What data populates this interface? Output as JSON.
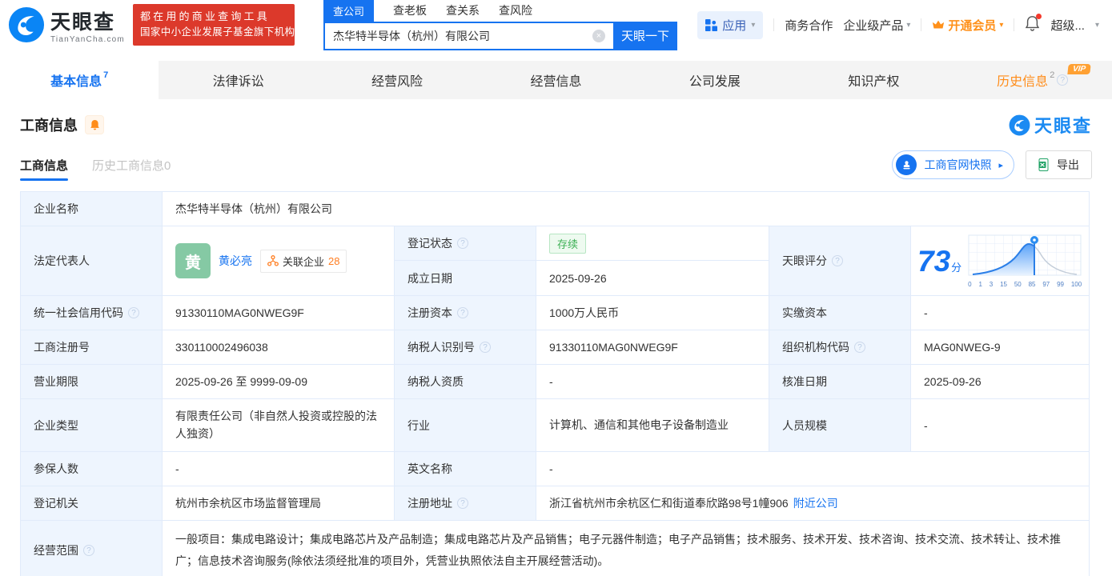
{
  "icons": {
    "caret": "▾",
    "arrow_right": "▸",
    "clear": "×",
    "help": "?",
    "vip": "VIP",
    "dots": "…"
  },
  "header": {
    "logo": {
      "brand": "天眼查",
      "domain": "TianYanCha.com"
    },
    "banner": {
      "line1": "都在用的商业查询工具",
      "line2": "国家中小企业发展子基金旗下机构"
    },
    "search": {
      "tabs": [
        {
          "label": "查公司"
        },
        {
          "label": "查老板"
        },
        {
          "label": "查关系"
        },
        {
          "label": "查风险"
        }
      ],
      "value": "杰华特半导体（杭州）有限公司",
      "button": "天眼一下"
    },
    "menu": {
      "apps": "应用",
      "business_coop": "商务合作",
      "enterprise_product": "企业级产品",
      "vip": "开通会员",
      "username": "超级..."
    }
  },
  "nav_tabs": [
    {
      "label": "基本信息",
      "count": "7"
    },
    {
      "label": "法律诉讼"
    },
    {
      "label": "经营风险"
    },
    {
      "label": "经营信息"
    },
    {
      "label": "公司发展"
    },
    {
      "label": "知识产权"
    },
    {
      "label": "历史信息",
      "count": "2"
    }
  ],
  "section": {
    "title": "工商信息",
    "watermark": "天眼查",
    "sub_tabs": [
      {
        "label": "工商信息"
      },
      {
        "label": "历史工商信息0"
      }
    ],
    "snapshot_button": "工商官网快照",
    "export_button": "导出"
  },
  "table": {
    "row1": {
      "label": "企业名称",
      "value": "杰华特半导体（杭州）有限公司"
    },
    "row2": {
      "label": "法定代表人",
      "avatar": "黄",
      "name": "黄必亮",
      "related_label": "关联企业",
      "related_count": "28",
      "reg_status_label": "登记状态",
      "reg_status": "存续",
      "establish_label": "成立日期",
      "establish_date": "2025-09-26",
      "score_label": "天眼评分",
      "score": "73",
      "score_unit": "分"
    },
    "row3": {
      "l1": "统一社会信用代码",
      "v1": "91330110MAG0NWEG9F",
      "l2": "注册资本",
      "v2": "1000万人民币",
      "l3": "实缴资本",
      "v3": "-"
    },
    "row4": {
      "l1": "工商注册号",
      "v1": "330110002496038",
      "l2": "纳税人识别号",
      "v2": "91330110MAG0NWEG9F",
      "l3": "组织机构代码",
      "v3": "MAG0NWEG-9"
    },
    "row5": {
      "l1": "营业期限",
      "v1": "2025-09-26 至 9999-09-09",
      "l2": "纳税人资质",
      "v2": "-",
      "l3": "核准日期",
      "v3": "2025-09-26"
    },
    "row6": {
      "l1": "企业类型",
      "v1": "有限责任公司（非自然人投资或控股的法人独资）",
      "l2": "行业",
      "v2": "计算机、通信和其他电子设备制造业",
      "l3": "人员规模",
      "v3": "-"
    },
    "row7": {
      "l1": "参保人数",
      "v1": "-",
      "l2": "英文名称",
      "v2": "-"
    },
    "row8": {
      "l1": "登记机关",
      "v1": "杭州市余杭区市场监督管理局",
      "l2": "注册地址",
      "v2": "浙江省杭州市余杭区仁和街道奉欣路98号1幢906",
      "link": "附近公司"
    },
    "row9": {
      "label": "经营范围",
      "value": "一般项目：集成电路设计；集成电路芯片及产品制造；集成电路芯片及产品销售；电子元器件制造；电子产品销售；技术服务、技术开发、技术咨询、技术交流、技术转让、技术推广；信息技术咨询服务(除依法须经批准的项目外，凭营业执照依法自主开展经营活动)。"
    }
  },
  "score_chart": {
    "type": "area",
    "axis": [
      "0",
      "1",
      "3",
      "15",
      "50",
      "85",
      "97",
      "99",
      "100"
    ],
    "marker_value": 73
  }
}
